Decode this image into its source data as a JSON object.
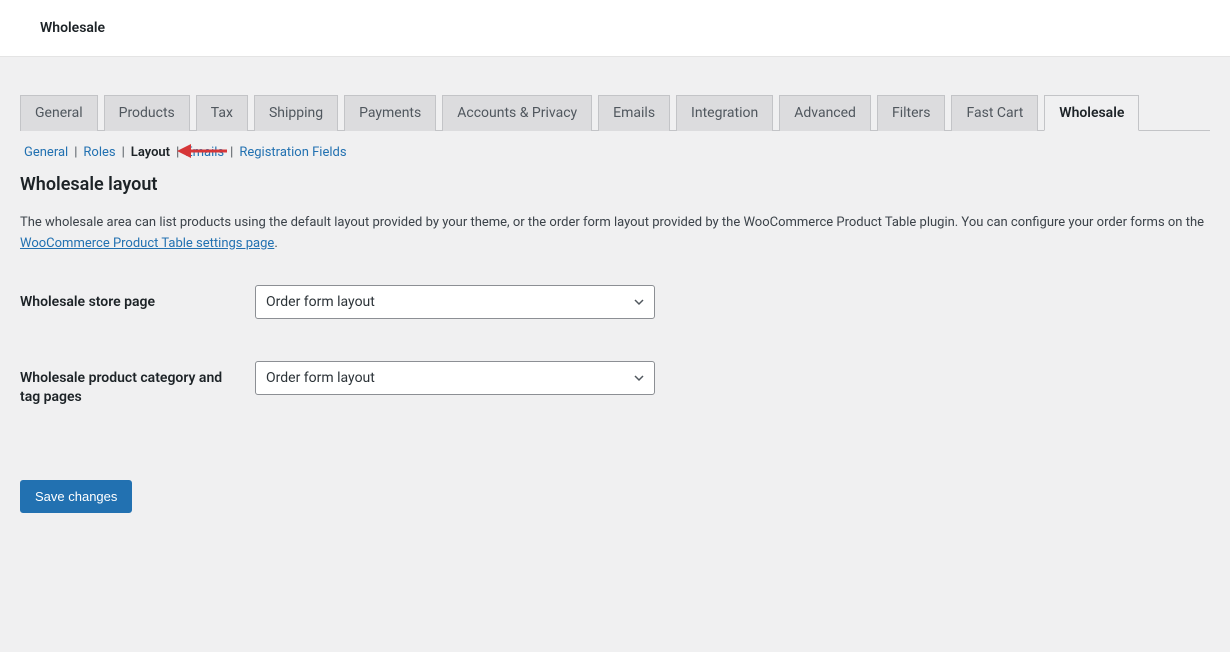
{
  "header": {
    "title": "Wholesale"
  },
  "tabs": [
    {
      "label": "General"
    },
    {
      "label": "Products"
    },
    {
      "label": "Tax"
    },
    {
      "label": "Shipping"
    },
    {
      "label": "Payments"
    },
    {
      "label": "Accounts & Privacy"
    },
    {
      "label": "Emails"
    },
    {
      "label": "Integration"
    },
    {
      "label": "Advanced"
    },
    {
      "label": "Filters"
    },
    {
      "label": "Fast Cart"
    },
    {
      "label": "Wholesale"
    }
  ],
  "subtabs": {
    "general": "General",
    "roles": "Roles",
    "layout": "Layout",
    "emails": "Emails",
    "registration": "Registration Fields",
    "separator": "|"
  },
  "section": {
    "title": "Wholesale layout",
    "desc_part1": "The wholesale area can list products using the default layout provided by your theme, or the order form layout provided by the WooCommerce Product Table plugin. You can configure your order forms on the ",
    "desc_link": "WooCommerce Product Table settings page",
    "desc_part2": "."
  },
  "form": {
    "row1": {
      "label": "Wholesale store page",
      "value": "Order form layout"
    },
    "row2": {
      "label": "Wholesale product category and tag pages",
      "value": "Order form layout"
    }
  },
  "button": {
    "save": "Save changes"
  }
}
